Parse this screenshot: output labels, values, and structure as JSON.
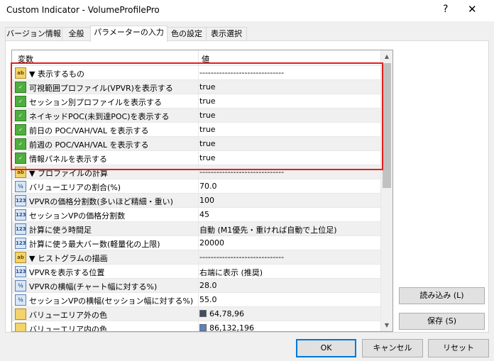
{
  "window": {
    "title": "Custom Indicator - VolumeProfilePro",
    "help": "?",
    "close": "✕"
  },
  "tabs": [
    {
      "label": "バージョン情報"
    },
    {
      "label": "全般"
    },
    {
      "label": "パラメーターの入力"
    },
    {
      "label": "色の設定"
    },
    {
      "label": "表示選択"
    }
  ],
  "grid": {
    "header_name": "変数",
    "header_value": "値",
    "rows": [
      {
        "icon": "ab",
        "name": "▼ 表示するもの",
        "value": "------------------------------"
      },
      {
        "icon": "bool",
        "name": "可視範囲プロファイル(VPVR)を表示する",
        "value": "true"
      },
      {
        "icon": "bool",
        "name": "セッション別プロファイルを表示する",
        "value": "true"
      },
      {
        "icon": "bool",
        "name": "ネイキッドPOC(未到達POC)を表示する",
        "value": "true"
      },
      {
        "icon": "bool",
        "name": "前日の POC/VAH/VAL を表示する",
        "value": "true"
      },
      {
        "icon": "bool",
        "name": "前週の POC/VAH/VAL を表示する",
        "value": "true"
      },
      {
        "icon": "bool",
        "name": "情報パネルを表示する",
        "value": "true"
      },
      {
        "icon": "ab",
        "name": "▼ プロファイルの計算",
        "value": "------------------------------"
      },
      {
        "icon": "frac",
        "name": "バリューエリアの割合(%)",
        "value": "70.0"
      },
      {
        "icon": "num",
        "name": "VPVRの価格分割数(多いほど精細・重い)",
        "value": "100"
      },
      {
        "icon": "num",
        "name": "セッションVPの価格分割数",
        "value": "45"
      },
      {
        "icon": "num",
        "name": "計算に使う時間足",
        "value": "自動 (M1優先・重ければ自動で上位足)"
      },
      {
        "icon": "num",
        "name": "計算に使う最大バー数(軽量化の上限)",
        "value": "20000"
      },
      {
        "icon": "ab",
        "name": "▼ ヒストグラムの描画",
        "value": "------------------------------"
      },
      {
        "icon": "num",
        "name": "VPVRを表示する位置",
        "value": "右端に表示 (推奨)"
      },
      {
        "icon": "frac",
        "name": "VPVRの横幅(チャート幅に対する%)",
        "value": "28.0"
      },
      {
        "icon": "frac",
        "name": "セッションVPの横幅(セッション幅に対する%)",
        "value": "55.0"
      },
      {
        "icon": "col",
        "name": "バリューエリア外の色",
        "value": "64,78,96",
        "swatch": "#404e60"
      },
      {
        "icon": "col",
        "name": "バリューエリア内の色",
        "value": "86,132,196",
        "swatch": "#5684c4"
      }
    ]
  },
  "icons": {
    "ab": "ab",
    "bool": "✓",
    "num": "123",
    "frac": "½"
  },
  "side_buttons": {
    "load": "読み込み (L)",
    "save": "保存 (S)"
  },
  "bottom_buttons": {
    "ok": "OK",
    "cancel": "キャンセル",
    "reset": "リセット"
  },
  "scroll": {
    "up": "▲",
    "down": "▼"
  }
}
